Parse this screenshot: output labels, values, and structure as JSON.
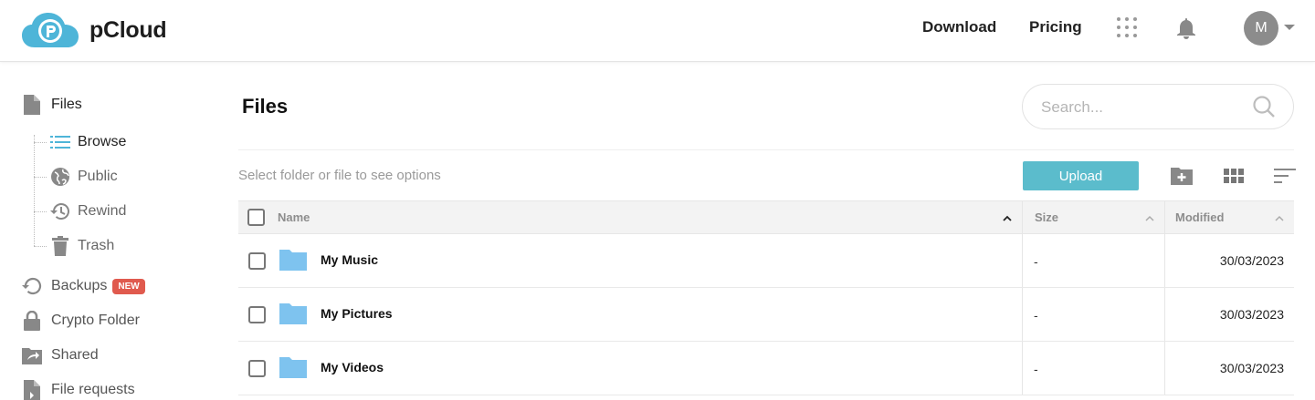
{
  "header": {
    "brand": "pCloud",
    "nav": [
      {
        "label": "Download"
      },
      {
        "label": "Pricing"
      }
    ],
    "avatar_initial": "M"
  },
  "sidebar": {
    "files_label": "Files",
    "sub_items": [
      {
        "label": "Browse",
        "icon": "list-icon"
      },
      {
        "label": "Public",
        "icon": "globe-icon"
      },
      {
        "label": "Rewind",
        "icon": "history-icon"
      },
      {
        "label": "Trash",
        "icon": "trash-icon"
      }
    ],
    "backups_label": "Backups",
    "backups_badge": "NEW",
    "crypto_label": "Crypto Folder",
    "shared_label": "Shared",
    "file_requests_label": "File requests"
  },
  "main": {
    "title": "Files",
    "search_placeholder": "Search...",
    "hint": "Select folder or file to see options",
    "upload_label": "Upload"
  },
  "table": {
    "columns": {
      "name": "Name",
      "size": "Size",
      "modified": "Modified"
    },
    "rows": [
      {
        "name": "My Music",
        "size": "-",
        "modified": "30/03/2023"
      },
      {
        "name": "My Pictures",
        "size": "-",
        "modified": "30/03/2023"
      },
      {
        "name": "My Videos",
        "size": "-",
        "modified": "30/03/2023"
      }
    ]
  },
  "colors": {
    "accent": "#5bbccc",
    "folder": "#7ec3ef",
    "badge": "#e05a4e",
    "logo": "#4eb5d8"
  }
}
